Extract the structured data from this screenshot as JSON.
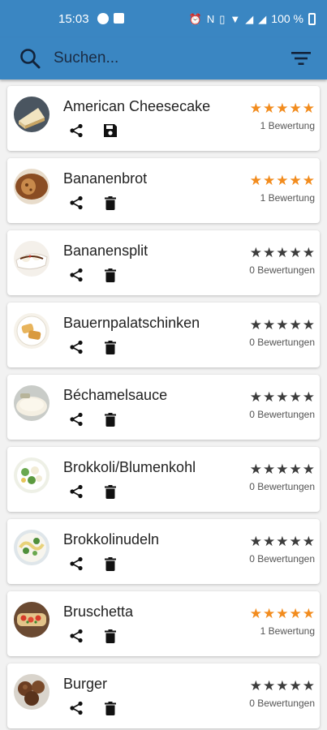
{
  "status_bar": {
    "time": "15:03",
    "battery": "100 %"
  },
  "search": {
    "placeholder": "Suchen..."
  },
  "colors": {
    "appbar": "#3a86c2",
    "star_filled": "#f28c1e",
    "star_empty": "#3d3d3d"
  },
  "recipes": [
    {
      "name": "American Cheesecake",
      "rating": 5,
      "rating_text": "1 Bewertung",
      "secondary_action": "save"
    },
    {
      "name": "Bananenbrot",
      "rating": 5,
      "rating_text": "1 Bewertung",
      "secondary_action": "delete"
    },
    {
      "name": "Bananensplit",
      "rating": 0,
      "rating_text": "0 Bewertungen",
      "secondary_action": "delete"
    },
    {
      "name": "Bauernpalatschinken",
      "rating": 0,
      "rating_text": "0 Bewertungen",
      "secondary_action": "delete"
    },
    {
      "name": "Béchamelsauce",
      "rating": 0,
      "rating_text": "0 Bewertungen",
      "secondary_action": "delete"
    },
    {
      "name": "Brokkoli/Blumenkohl",
      "rating": 0,
      "rating_text": "0 Bewertungen",
      "secondary_action": "delete"
    },
    {
      "name": "Brokkolinudeln",
      "rating": 0,
      "rating_text": "0 Bewertungen",
      "secondary_action": "delete"
    },
    {
      "name": "Bruschetta",
      "rating": 5,
      "rating_text": "1 Bewertung",
      "secondary_action": "delete"
    },
    {
      "name": "Burger",
      "rating": 0,
      "rating_text": "0 Bewertungen",
      "secondary_action": "delete"
    }
  ]
}
